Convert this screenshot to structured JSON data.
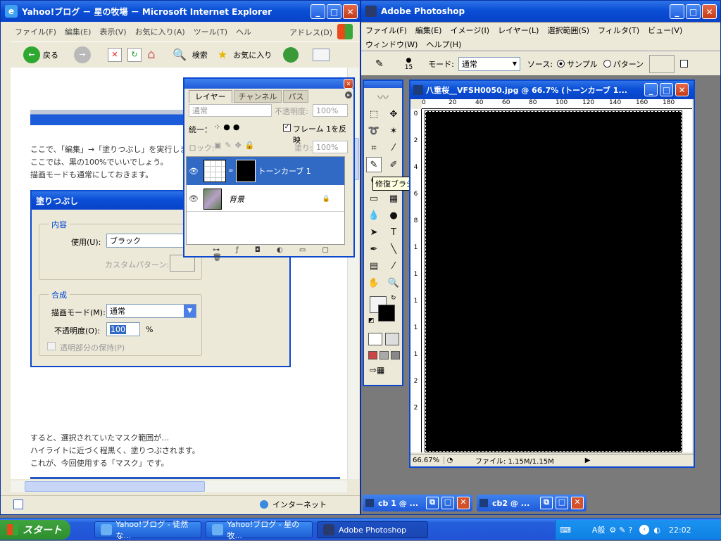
{
  "ie": {
    "title": "Yahoo!ブログ － 星の牧場 － Microsoft Internet Explorer",
    "menu": [
      "ファイル(F)",
      "編集(E)",
      "表示(V)",
      "お気に入り(A)",
      "ツール(T)",
      "ヘル"
    ],
    "address_label": "アドレス(D)",
    "toolbar": {
      "back": "戻る",
      "search": "検索",
      "favorites": "お気に入り"
    },
    "content": {
      "para1": [
        "ここで、「編集」→「塗りつぶし」を実行します",
        "ここでは、黒の100%でいいでしょう。",
        "描画モードも通常にしておきます。"
      ],
      "para2": [
        "すると、選択されていたマスク範囲が…",
        "ハイライトに近づく程黒く、塗りつぶされます。",
        "これが、今回使用する「マスク」です。"
      ]
    },
    "fill_dialog": {
      "title": "塗りつぶし",
      "contents_group": "内容",
      "use_label": "使用(U):",
      "use_value": "ブラック",
      "custom_pattern_label": "カスタムパターン:",
      "blend_group": "合成",
      "mode_label": "描画モード(M):",
      "mode_value": "通常",
      "opacity_label": "不透明度(O):",
      "opacity_value": "100",
      "percent": "%",
      "preserve_label": "透明部分の保持(P)"
    },
    "status": {
      "zone": "インターネット"
    }
  },
  "ps": {
    "title": "Adobe Photoshop",
    "menu": [
      "ファイル(F)",
      "編集(E)",
      "イメージ(I)",
      "レイヤー(L)",
      "選択範囲(S)",
      "フィルタ(T)",
      "ビュー(V)"
    ],
    "menu2": [
      "ウィンドウ(W)",
      "ヘルプ(H)"
    ],
    "options": {
      "brush_size": "15",
      "mode_label": "モード:",
      "mode_value": "通常",
      "source_label": "ソース:",
      "sampled": "サンプル",
      "pattern": "パターン"
    },
    "tooltip": "修復ブラシツール (J)",
    "doc": {
      "title": "八重桜__VFSH0050.jpg @ 66.7% (トーンカーブ 1...",
      "zoom": "66.67%",
      "file_info": "ファイル: 1.15M/1.15M",
      "ruler_ticks": [
        "0",
        "20",
        "40",
        "60",
        "80",
        "100",
        "120",
        "140",
        "160",
        "180"
      ],
      "vruler_ticks": [
        "0",
        "2",
        "4",
        "6",
        "8",
        "1",
        "1",
        "1",
        "1",
        "1",
        "2",
        "2"
      ]
    },
    "layers": {
      "tabs": [
        "レイヤー",
        "チャンネル",
        "パス"
      ],
      "blend": "通常",
      "opacity_label": "不透明度:",
      "opacity_value": "100%",
      "unify_label": "統一：",
      "frame_label": "フレーム 1を反映",
      "lock_label": "ロック:",
      "fill_label": "塗り:",
      "fill_value": "100%",
      "items": [
        {
          "name": "トーンカーブ 1",
          "selected": true
        },
        {
          "name": "背景",
          "selected": false
        }
      ]
    },
    "minimized": [
      "cb 1 @ ...",
      "cb2 @ ..."
    ]
  },
  "taskbar": {
    "start": "スタート",
    "items": [
      "Yahoo!ブログ - 徒然な...",
      "Yahoo!ブログ - 星の牧...",
      "Adobe Photoshop"
    ],
    "ime": "A般",
    "time": "22:02"
  },
  "colors": {
    "xp_blue": "#0a4fd6",
    "selection": "#316ac5",
    "dialog_bg": "#ece9d8",
    "ps_bg": "#7a7a7a"
  }
}
